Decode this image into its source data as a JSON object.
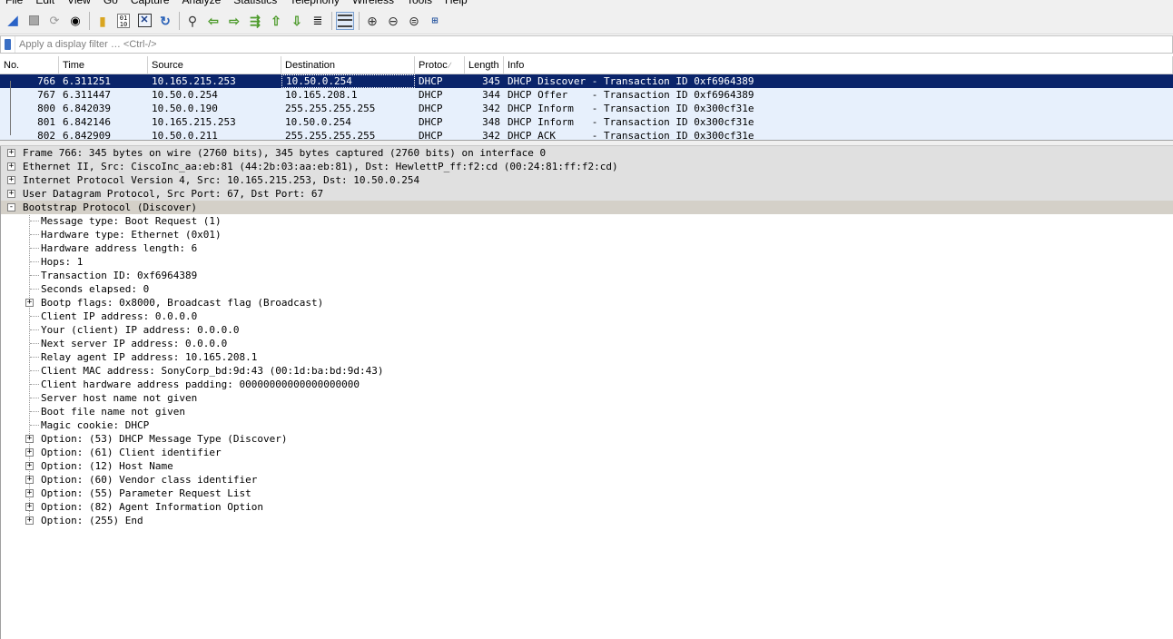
{
  "menu": [
    "File",
    "Edit",
    "View",
    "Go",
    "Capture",
    "Analyze",
    "Statistics",
    "Telephony",
    "Wireless",
    "Tools",
    "Help"
  ],
  "toolbar": {
    "buttons": [
      {
        "name": "start-capture-icon",
        "glyph": "shark-fin"
      },
      {
        "name": "stop-capture-icon",
        "glyph": "stop"
      },
      {
        "name": "restart-capture-icon",
        "glyph": "restart"
      },
      {
        "name": "capture-options-icon",
        "glyph": "gear"
      },
      {
        "name": "open-file-icon",
        "glyph": "folder"
      },
      {
        "name": "save-file-icon",
        "glyph": "binary"
      },
      {
        "name": "close-file-icon",
        "glyph": "close"
      },
      {
        "name": "reload-file-icon",
        "glyph": "reload"
      },
      {
        "name": "find-packet-icon",
        "glyph": "magnifier"
      },
      {
        "name": "go-back-icon",
        "glyph": "arrow-left"
      },
      {
        "name": "go-forward-icon",
        "glyph": "arrow-right"
      },
      {
        "name": "go-to-packet-icon",
        "glyph": "goto"
      },
      {
        "name": "go-first-packet-icon",
        "glyph": "arrow-up"
      },
      {
        "name": "go-last-packet-icon",
        "glyph": "arrow-down"
      },
      {
        "name": "auto-scroll-icon",
        "glyph": "autoscroll"
      },
      {
        "name": "colorize-icon",
        "glyph": "lines"
      },
      {
        "name": "zoom-in-icon",
        "glyph": "zoom-in"
      },
      {
        "name": "zoom-out-icon",
        "glyph": "zoom-out"
      },
      {
        "name": "zoom-normal-icon",
        "glyph": "zoom-normal"
      },
      {
        "name": "resize-columns-icon",
        "glyph": "resize"
      }
    ]
  },
  "filter": {
    "placeholder": "Apply a display filter … <Ctrl-/>",
    "value": ""
  },
  "packet_list": {
    "columns": [
      "No.",
      "Time",
      "Source",
      "Destination",
      "Protoc",
      "Length",
      "Info"
    ],
    "sort_indicator": "∕",
    "rows": [
      {
        "no": "766",
        "time": "6.311251",
        "source": "10.165.215.253",
        "destination": "10.50.0.254",
        "protocol": "DHCP",
        "length": "345",
        "info": "DHCP Discover - Transaction ID 0xf6964389",
        "selected": true
      },
      {
        "no": "767",
        "time": "6.311447",
        "source": "10.50.0.254",
        "destination": "10.165.208.1",
        "protocol": "DHCP",
        "length": "344",
        "info": "DHCP Offer    - Transaction ID 0xf6964389",
        "selected": false
      },
      {
        "no": "800",
        "time": "6.842039",
        "source": "10.50.0.190",
        "destination": "255.255.255.255",
        "protocol": "DHCP",
        "length": "342",
        "info": "DHCP Inform   - Transaction ID 0x300cf31e",
        "selected": false
      },
      {
        "no": "801",
        "time": "6.842146",
        "source": "10.165.215.253",
        "destination": "10.50.0.254",
        "protocol": "DHCP",
        "length": "348",
        "info": "DHCP Inform   - Transaction ID 0x300cf31e",
        "selected": false
      },
      {
        "no": "802",
        "time": "6.842909",
        "source": "10.50.0.211",
        "destination": "255.255.255.255",
        "protocol": "DHCP",
        "length": "342",
        "info": "DHCP ACK      - Transaction ID 0x300cf31e",
        "selected": false
      }
    ]
  },
  "detail_tree": [
    {
      "level": 0,
      "toggle": "+",
      "text": "Frame 766: 345 bytes on wire (2760 bits), 345 bytes captured (2760 bits) on interface 0"
    },
    {
      "level": 0,
      "toggle": "+",
      "text": "Ethernet II, Src: CiscoInc_aa:eb:81 (44:2b:03:aa:eb:81), Dst: HewlettP_ff:f2:cd (00:24:81:ff:f2:cd)"
    },
    {
      "level": 0,
      "toggle": "+",
      "text": "Internet Protocol Version 4, Src: 10.165.215.253, Dst: 10.50.0.254"
    },
    {
      "level": 0,
      "toggle": "+",
      "text": "User Datagram Protocol, Src Port: 67, Dst Port: 67"
    },
    {
      "level": 0,
      "toggle": "-",
      "text": "Bootstrap Protocol (Discover)",
      "expanded": true
    },
    {
      "level": 1,
      "toggle": "",
      "text": "Message type: Boot Request (1)"
    },
    {
      "level": 1,
      "toggle": "",
      "text": "Hardware type: Ethernet (0x01)"
    },
    {
      "level": 1,
      "toggle": "",
      "text": "Hardware address length: 6"
    },
    {
      "level": 1,
      "toggle": "",
      "text": "Hops: 1"
    },
    {
      "level": 1,
      "toggle": "",
      "text": "Transaction ID: 0xf6964389"
    },
    {
      "level": 1,
      "toggle": "",
      "text": "Seconds elapsed: 0"
    },
    {
      "level": 1,
      "toggle": "+",
      "text": "Bootp flags: 0x8000, Broadcast flag (Broadcast)"
    },
    {
      "level": 1,
      "toggle": "",
      "text": "Client IP address: 0.0.0.0"
    },
    {
      "level": 1,
      "toggle": "",
      "text": "Your (client) IP address: 0.0.0.0"
    },
    {
      "level": 1,
      "toggle": "",
      "text": "Next server IP address: 0.0.0.0"
    },
    {
      "level": 1,
      "toggle": "",
      "text": "Relay agent IP address: 10.165.208.1"
    },
    {
      "level": 1,
      "toggle": "",
      "text": "Client MAC address: SonyCorp_bd:9d:43 (00:1d:ba:bd:9d:43)"
    },
    {
      "level": 1,
      "toggle": "",
      "text": "Client hardware address padding: 00000000000000000000"
    },
    {
      "level": 1,
      "toggle": "",
      "text": "Server host name not given"
    },
    {
      "level": 1,
      "toggle": "",
      "text": "Boot file name not given"
    },
    {
      "level": 1,
      "toggle": "",
      "text": "Magic cookie: DHCP"
    },
    {
      "level": 1,
      "toggle": "+",
      "text": "Option: (53) DHCP Message Type (Discover)"
    },
    {
      "level": 1,
      "toggle": "+",
      "text": "Option: (61) Client identifier"
    },
    {
      "level": 1,
      "toggle": "+",
      "text": "Option: (12) Host Name"
    },
    {
      "level": 1,
      "toggle": "+",
      "text": "Option: (60) Vendor class identifier"
    },
    {
      "level": 1,
      "toggle": "+",
      "text": "Option: (55) Parameter Request List"
    },
    {
      "level": 1,
      "toggle": "+",
      "text": "Option: (82) Agent Information Option"
    },
    {
      "level": 1,
      "toggle": "+",
      "text": "Option: (255) End"
    }
  ],
  "colors": {
    "selected_row": "#0a246a",
    "row_bg": "#e7f0fc",
    "tree_header_bg": "#e0e0e0"
  }
}
